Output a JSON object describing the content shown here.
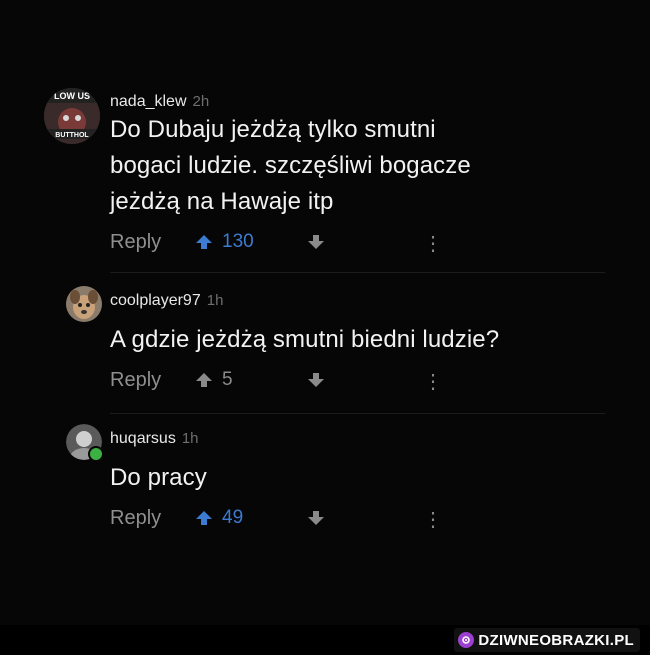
{
  "comments": [
    {
      "username": "nada_klew",
      "time": "2h",
      "avatar_text_top": "LOW US",
      "avatar_text_bottom": "BUTTHOL",
      "lines": [
        "Do Dubaju jeżdżą tylko smutni",
        "bogaci ludzie. szczęśliwi bogacze",
        "jeżdżą na Hawaje itp"
      ],
      "reply_label": "Reply",
      "score": "130",
      "score_color": "#3b7bd1",
      "upvoted": true,
      "more": "⋮"
    },
    {
      "username": "coolplayer97",
      "time": "1h",
      "lines": [
        "A gdzie jeżdżą smutni biedni ludzie?"
      ],
      "reply_label": "Reply",
      "score": "5",
      "score_color": "#8a8a8a",
      "upvoted": false,
      "more": "⋮"
    },
    {
      "username": "huqarsus",
      "time": "1h",
      "online": true,
      "lines": [
        "Do pracy"
      ],
      "reply_label": "Reply",
      "score": "49",
      "score_color": "#3b7bd1",
      "upvoted": true,
      "more": "⋮"
    }
  ],
  "watermark": "DZIWNEOBRAZKI.PL"
}
